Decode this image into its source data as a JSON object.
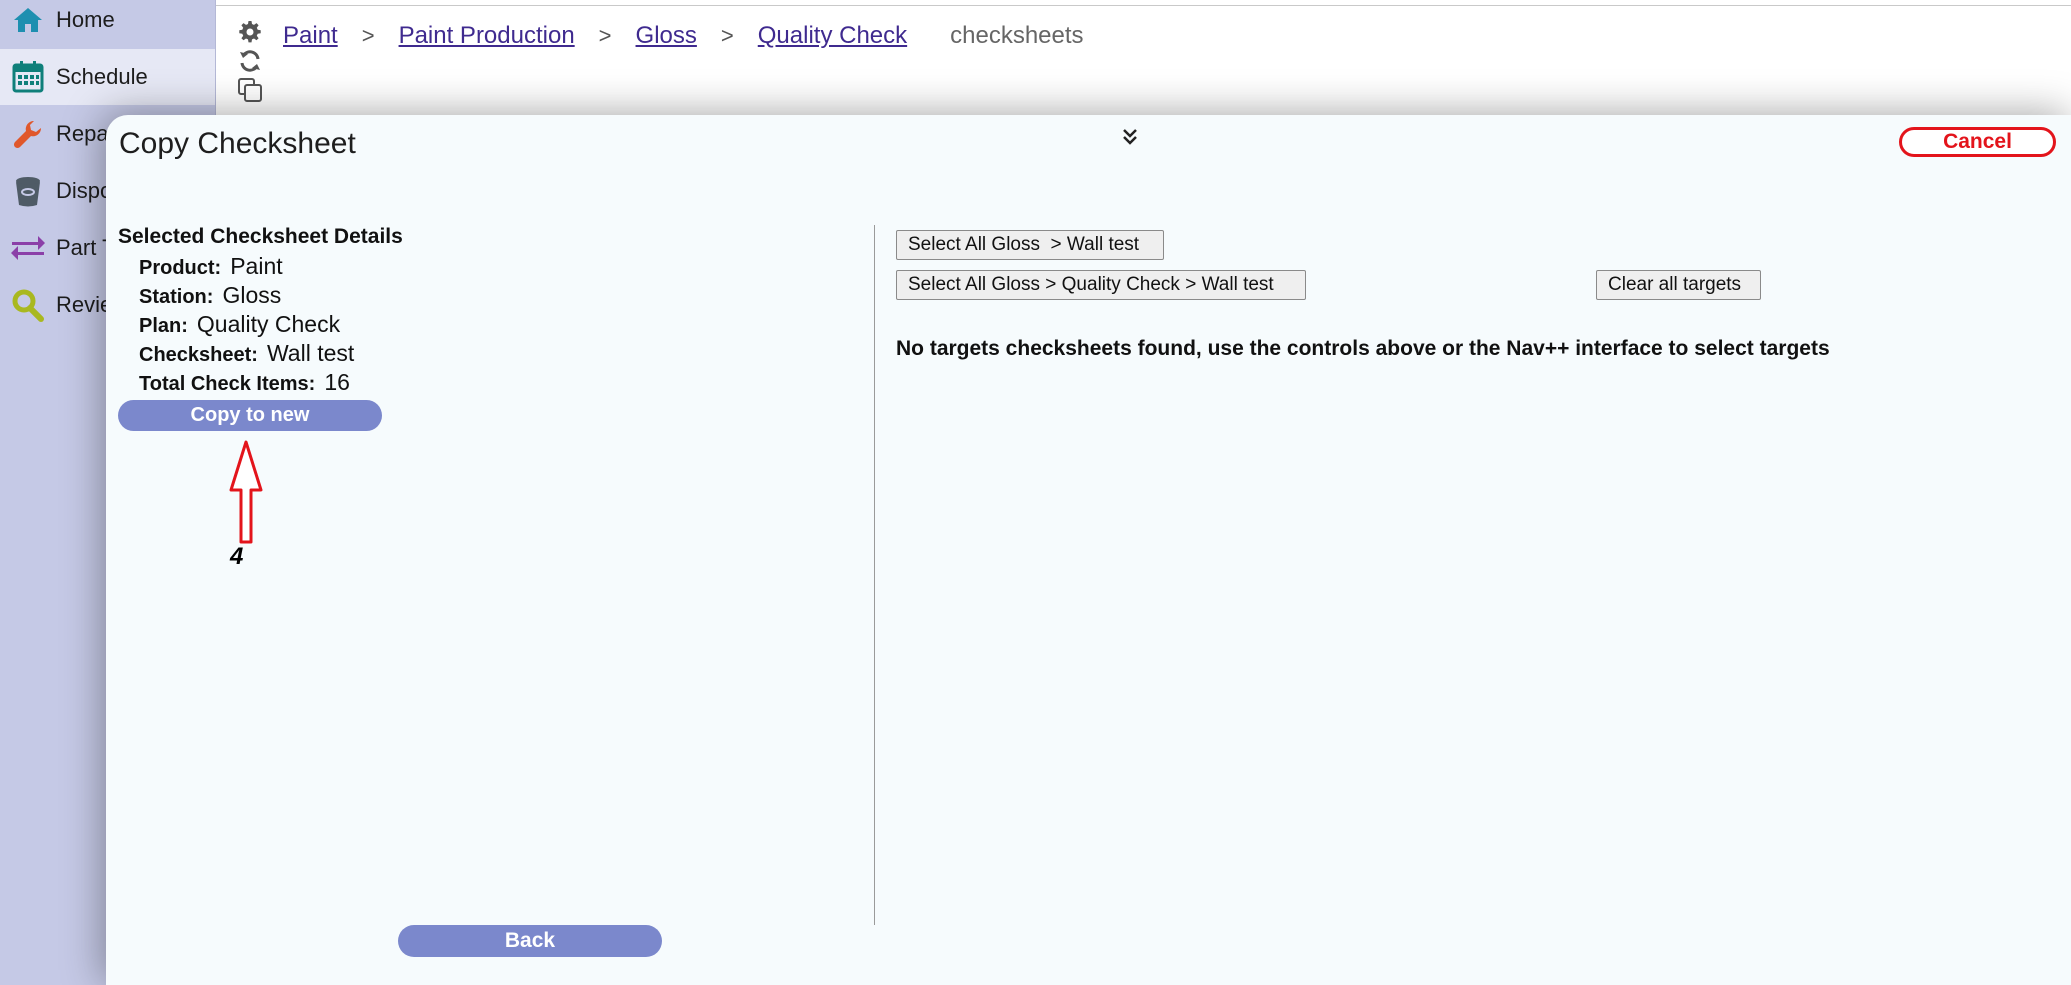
{
  "sidebar": {
    "items": [
      {
        "label": "Home",
        "icon": "home-icon"
      },
      {
        "label": "Schedule",
        "icon": "calendar-icon"
      },
      {
        "label": "Repa",
        "icon": "wrench-icon"
      },
      {
        "label": "Dispo",
        "icon": "bin-icon"
      },
      {
        "label": "Part T",
        "icon": "transfer-arrows-icon"
      },
      {
        "label": "Revie",
        "icon": "magnifier-icon"
      }
    ]
  },
  "header": {
    "icons": [
      "gear-icon",
      "refresh-icon",
      "copy-icon"
    ],
    "breadcrumb": {
      "items": [
        "Paint",
        "Paint Production",
        "Gloss",
        "Quality Check"
      ],
      "separator": ">",
      "current": "checksheets"
    }
  },
  "modal": {
    "title": "Copy Checksheet",
    "cancel_label": "Cancel",
    "details": {
      "heading": "Selected Checksheet Details",
      "product_label": "Product:",
      "product_value": "Paint",
      "station_label": "Station:",
      "station_value": "Gloss",
      "plan_label": "Plan:",
      "plan_value": "Quality Check",
      "checksheet_label": "Checksheet:",
      "checksheet_value": "Wall test",
      "total_label": "Total Check Items:",
      "total_value": "16"
    },
    "copy_to_new_label": "Copy to new",
    "annotation_number": "4",
    "back_label": "Back",
    "targets": {
      "select_all_station_label": "Select All Gloss  > Wall test",
      "select_all_plan_label": "Select All Gloss > Quality Check > Wall test",
      "clear_all_label": "Clear all targets",
      "empty_message": "No targets checksheets found, use the controls above or the Nav++ interface to select targets"
    }
  },
  "colors": {
    "sidebar_bg": "#c5c9e6",
    "accent_button": "#7b88cc",
    "cancel_red": "#e3141b",
    "link_purple": "#3f2a8f",
    "annotation_red": "#e3141b"
  }
}
